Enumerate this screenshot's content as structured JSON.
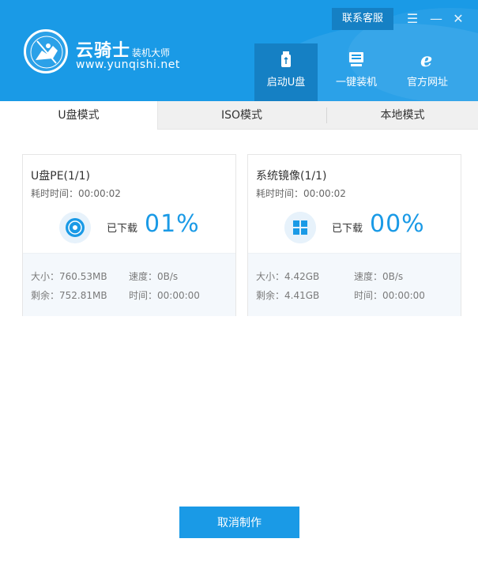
{
  "header": {
    "brand_name": "云骑士",
    "brand_sub": "装机大师",
    "brand_url": "www.yunqishi.net",
    "contact_label": "联系客服",
    "menu_icon": "☰",
    "minimize_icon": "—",
    "close_icon": "✕",
    "nav": [
      {
        "label": "启动U盘",
        "icon": "usb-drive-icon",
        "active": true
      },
      {
        "label": "一键装机",
        "icon": "monitor-icon",
        "active": false
      },
      {
        "label": "官方网址",
        "icon": "ie-browser-icon",
        "active": false
      }
    ],
    "colors": {
      "primary": "#1a9ae6",
      "active": "#1580c4"
    }
  },
  "tabs": [
    {
      "label": "U盘模式",
      "active": true
    },
    {
      "label": "ISO模式",
      "active": false
    },
    {
      "label": "本地模式",
      "active": false
    }
  ],
  "downloads": [
    {
      "title": "U盘PE(1/1)",
      "elapsed": "耗时时间：00:00:02",
      "icon": "disc-icon",
      "status": "已下载",
      "percent": "01%",
      "size": "大小：760.53MB",
      "speed": "速度：0B/s",
      "remaining": "剩余：752.81MB",
      "time": "时间：00:00:00"
    },
    {
      "title": "系统镜像(1/1)",
      "elapsed": "耗时时间：00:00:02",
      "icon": "windows-icon",
      "status": "已下载",
      "percent": "00%",
      "size": "大小：4.42GB",
      "speed": "速度：0B/s",
      "remaining": "剩余：4.41GB",
      "time": "时间：00:00:00"
    }
  ],
  "footer": {
    "cancel_label": "取消制作"
  }
}
